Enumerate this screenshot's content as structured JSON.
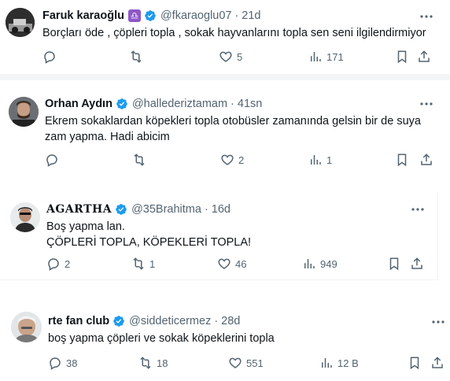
{
  "tweets": [
    {
      "name": "Faruk karaoğlu",
      "handle": "@fkaraoglu07",
      "time": "21d",
      "zodiac": "♎",
      "text_lines": [
        "Borçları öde , çöpleri topla , sokak hayvanlarını topla sen seni ilgilendirmiyor"
      ],
      "counts": {
        "reply": "",
        "retweet": "",
        "like": "5",
        "views": "171"
      }
    },
    {
      "name": "Orhan Aydın",
      "handle": "@hallederiztamam",
      "time": "41sn",
      "text_lines": [
        "Ekrem sokaklardan köpekleri topla otobüsler zamanında gelsin bir de suya",
        "zam yapma. Hadi abicim"
      ],
      "counts": {
        "reply": "",
        "retweet": "",
        "like": "2",
        "views": "1"
      }
    },
    {
      "name": "AGARTHA",
      "handle": "@35Brahitma",
      "time": "16d",
      "text_lines": [
        "Boş yapma lan.",
        "ÇÖPLERİ TOPLA, KÖPEKLERİ TOPLA!"
      ],
      "counts": {
        "reply": "2",
        "retweet": "1",
        "like": "46",
        "views": "949"
      }
    },
    {
      "name": "rte fan club",
      "handle": "@siddeticermez",
      "time": "28d",
      "text_lines": [
        "boş yapma çöpleri ve sokak köpeklerini topla"
      ],
      "counts": {
        "reply": "38",
        "retweet": "18",
        "like": "551",
        "views": "12 B"
      }
    }
  ],
  "separator": "·",
  "colors": {
    "verified": "#1d9bf0",
    "muted": "#536471",
    "text": "#0f1419",
    "zodiac_bg": "#8e57c7"
  },
  "icons": [
    "more-icon",
    "reply-icon",
    "retweet-icon",
    "like-icon",
    "views-icon",
    "bookmark-icon",
    "share-icon",
    "verified-badge-icon"
  ]
}
